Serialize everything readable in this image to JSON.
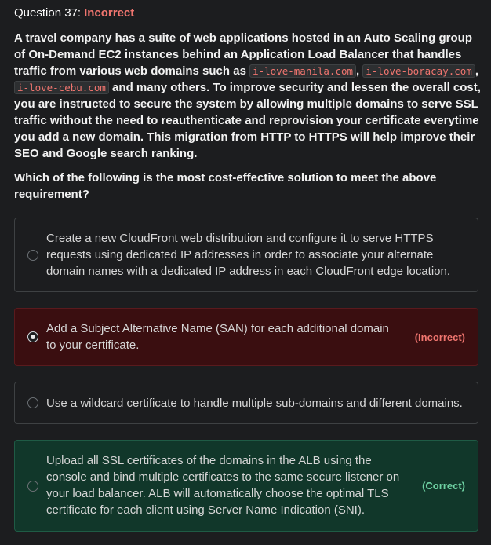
{
  "header": {
    "question_label": "Question 37:",
    "status": "Incorrect",
    "status_color": "#f0756f"
  },
  "question": {
    "part1": "A travel company has a suite of web applications hosted in an Auto Scaling group of On-Demand EC2 instances behind an Application Load Balancer that handles traffic from various web domains such as ",
    "domain1": "i-love-manila.com",
    "sep1": ", ",
    "domain2": "i-love-boracay.com",
    "sep2": ", ",
    "domain3": "i-love-cebu.com",
    "part2": " and many others. To improve security and lessen the overall cost, you are instructed to secure the system by allowing multiple domains to serve SSL traffic without the need to reauthenticate and reprovision your certificate everytime you add a new domain. This migration from HTTP to HTTPS will help improve their SEO and Google search ranking."
  },
  "prompt": "Which of the following is the most cost-effective solution to meet the above requirement?",
  "options": [
    {
      "text": "Create a new CloudFront web distribution and configure it to serve HTTPS requests using dedicated IP addresses in order to associate your alternate domain names with a dedicated IP address in each CloudFront edge location.",
      "selected": false,
      "verdict": ""
    },
    {
      "text": "Add a Subject Alternative Name (SAN) for each additional domain to your certificate.",
      "selected": true,
      "verdict": "(Incorrect)",
      "verdict_color": "#f0756f"
    },
    {
      "text": "Use a wildcard certificate to handle multiple sub-domains and different domains.",
      "selected": false,
      "verdict": ""
    },
    {
      "text": "Upload all SSL certificates of the domains in the ALB using the console and bind multiple certificates to the same secure listener on your load balancer. ALB will automatically choose the optimal TLS certificate for each client using Server Name Indication (SNI).",
      "selected": false,
      "verdict": "(Correct)",
      "verdict_color": "#6fd3a4"
    }
  ]
}
